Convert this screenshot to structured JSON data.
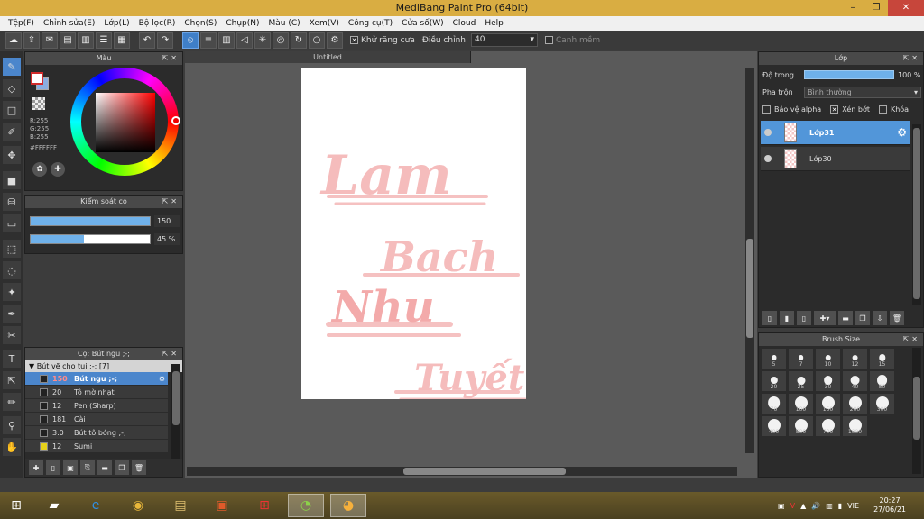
{
  "window": {
    "title": "MediBang Paint Pro (64bit)",
    "min": "–",
    "max": "❐",
    "close": "✕"
  },
  "menu": [
    "Tệp(F)",
    "Chỉnh sửa(E)",
    "Lớp(L)",
    "Bộ lọc(R)",
    "Chọn(S)",
    "Chụp(N)",
    "Màu (C)",
    "Xem(V)",
    "Công cụ(T)",
    "Cửa số(W)",
    "Cloud",
    "Help"
  ],
  "toolbar": {
    "antialias_label": "Khử răng cưa",
    "correction_label": "Điều chỉnh",
    "correction_value": "40",
    "snap_label": "Canh mềm"
  },
  "color_panel": {
    "title": "Màu",
    "r": "R:255",
    "g": "G:255",
    "b": "B:255",
    "hex": "#FFFFFF",
    "main_color": "#ffffff",
    "secondary_color": "#8aaee0"
  },
  "brush_control": {
    "title": "Kiểm soát cọ",
    "size_value": "150",
    "opacity_value": "45 %",
    "size_fraction": 1.0,
    "opacity_fraction": 0.45
  },
  "brush_list": {
    "title": "Cọ: Bút ngu ;-;",
    "group": "Bút vẽ cho tui ;-; [7]",
    "items": [
      {
        "size": "150",
        "name": "Bút ngu ;-;",
        "selected": true,
        "swatch": "#222222"
      },
      {
        "size": "20",
        "name": "Tô mờ nhạt",
        "selected": false,
        "swatch": "#222222"
      },
      {
        "size": "12",
        "name": "Pen (Sharp)",
        "selected": false,
        "swatch": "#222222"
      },
      {
        "size": "181",
        "name": "Cài",
        "selected": false,
        "swatch": "#222222"
      },
      {
        "size": "3.0",
        "name": "Bút tô bóng ;-;",
        "selected": false,
        "swatch": "#222222"
      },
      {
        "size": "12",
        "name": "Sumi",
        "selected": false,
        "swatch": "#e6d21a"
      }
    ]
  },
  "canvas": {
    "tab": "Untitled",
    "words": [
      "Lam",
      "Bach",
      "Nhu",
      "Tuyết"
    ]
  },
  "layer_panel": {
    "title": "Lớp",
    "opacity_label": "Độ trong",
    "opacity_value": "100 %",
    "blend_label": "Pha trộn",
    "blend_value": "Bình thường",
    "protect_alpha": "Bảo vệ alpha",
    "clipping": "Xén bớt",
    "lock": "Khóa",
    "layers": [
      {
        "name": "Lớp31",
        "selected": true
      },
      {
        "name": "Lớp30",
        "selected": false
      }
    ]
  },
  "brush_size": {
    "title": "Brush Size",
    "sizes": [
      "5",
      "7",
      "10",
      "12",
      "15",
      "20",
      "25",
      "30",
      "40",
      "50",
      "70",
      "100",
      "150",
      "200",
      "300",
      "400",
      "500",
      "700",
      "1000"
    ]
  },
  "taskbar": {
    "lang": "VIE",
    "time": "20:27",
    "date": "27/06/21"
  }
}
